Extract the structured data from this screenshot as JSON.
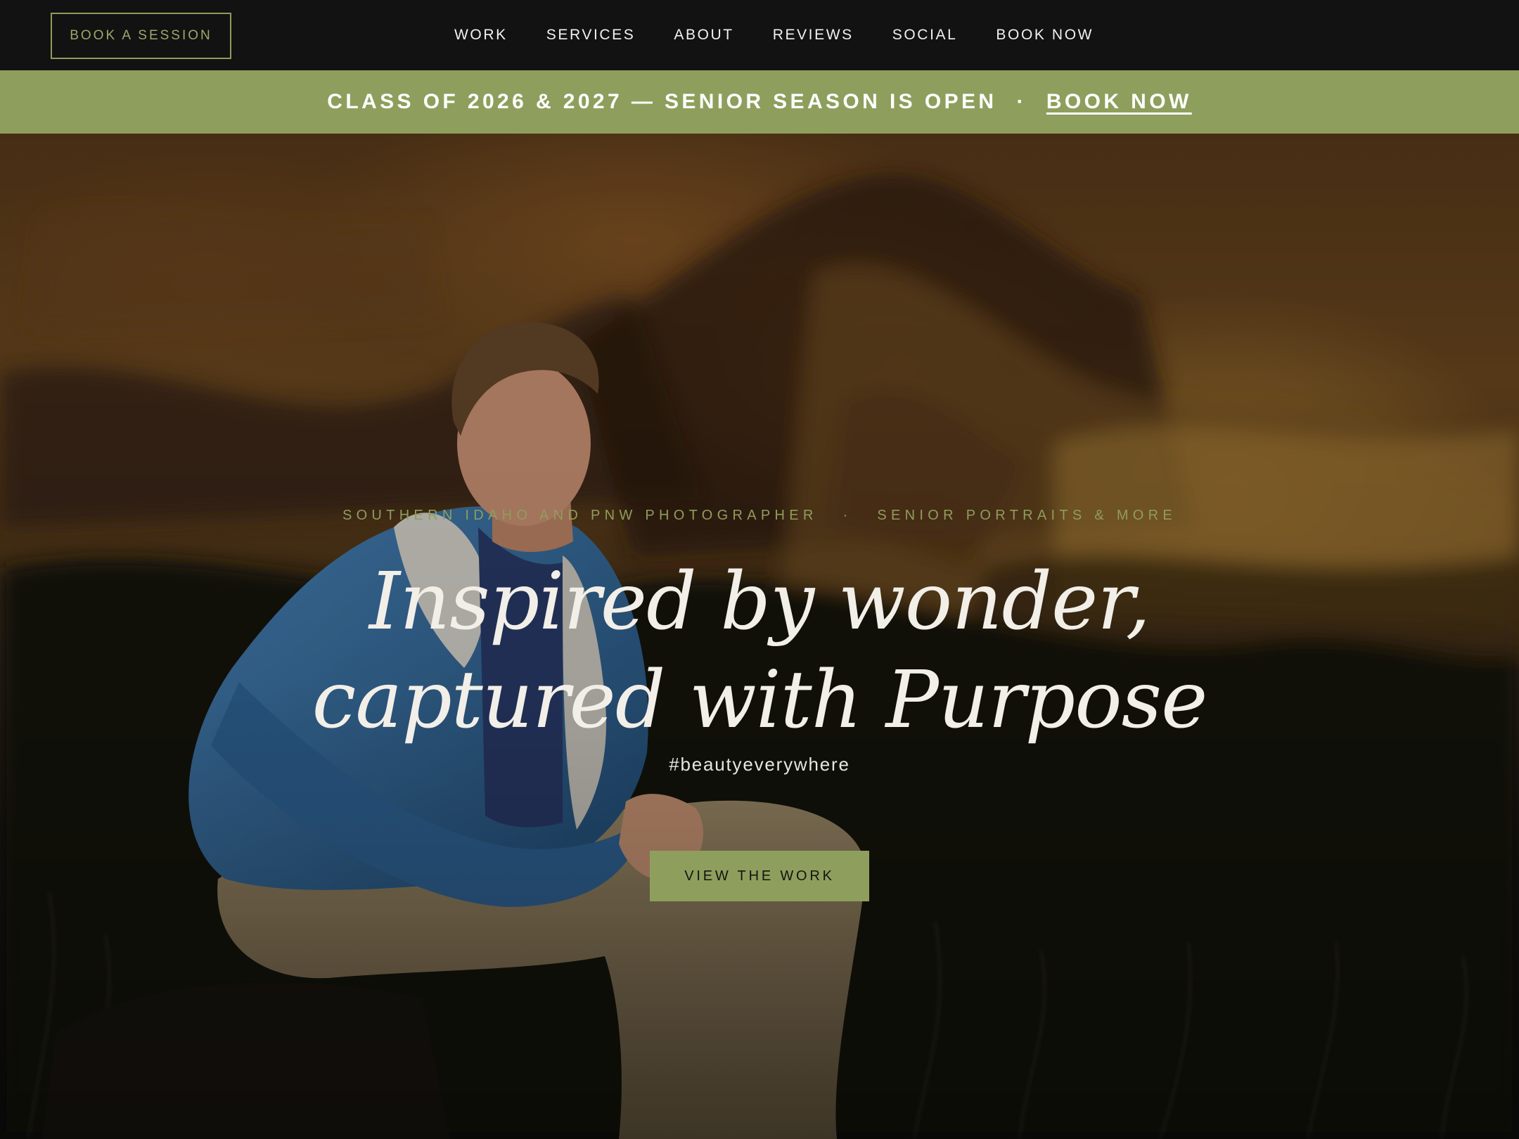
{
  "header": {
    "book_session_label": "BOOK A SESSION",
    "nav": [
      "WORK",
      "SERVICES",
      "ABOUT",
      "REVIEWS",
      "SOCIAL",
      "BOOK NOW"
    ]
  },
  "announcement": {
    "text": "CLASS OF 2026 & 2027 — SENIOR SEASON IS OPEN",
    "separator": "·",
    "link_label": "BOOK NOW"
  },
  "hero": {
    "eyebrow_left": "SOUTHERN IDAHO AND PNW PHOTOGRAPHER",
    "eyebrow_separator": "·",
    "eyebrow_right": "SENIOR PORTRAITS & MORE",
    "headline_line1": "Inspired by wonder,",
    "headline_line2": "captured with Purpose",
    "hashtag": "#beautyeverywhere",
    "cta_label": "VIEW THE WORK"
  },
  "colors": {
    "accent": "#8e9f5d",
    "nav_background": "#121212",
    "headline_text": "#f2efe8"
  }
}
